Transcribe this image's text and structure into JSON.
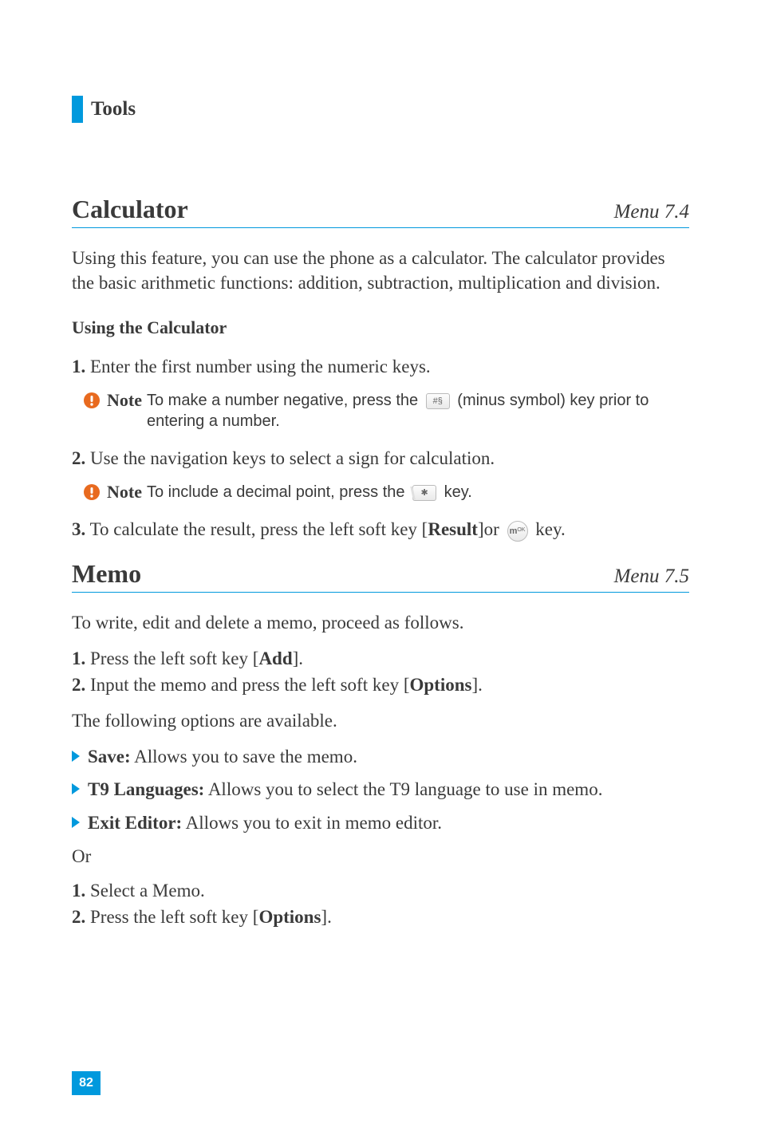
{
  "header": {
    "title": "Tools"
  },
  "section1": {
    "heading": "Calculator",
    "menu_ref": "Menu 7.4",
    "intro": "Using this feature, you can use the phone as a calculator. The calculator provides the basic arithmetic functions: addition, subtraction, multiplication and division.",
    "subheading": "Using the Calculator",
    "step1_num": "1.",
    "step1_text": " Enter the first number using the numeric keys.",
    "note1_label": "Note",
    "note1_pre": "To make a number negative, press the ",
    "note1_post": " (minus symbol) key prior to entering a number.",
    "hash_key_glyph": "#§",
    "step2_num": "2.",
    "step2_text": " Use the navigation keys to select a sign for calculation.",
    "note2_label": "Note",
    "note2_pre": "To include a decimal point, press the ",
    "note2_post": " key.",
    "star_key_glyph": "✱",
    "step3_num": "3.",
    "step3_pre": " To calculate the result, press the left soft key [",
    "step3_result": "Result",
    "step3_mid": "]or ",
    "step3_post": " key.",
    "ok_key_top": "m",
    "ok_key_sub": "OK"
  },
  "section2": {
    "heading": "Memo",
    "menu_ref": "Menu 7.5",
    "intro": "To write, edit and delete a memo, proceed as follows.",
    "step1_num": "1.",
    "step1_pre": " Press the left soft key [",
    "step1_bold": "Add",
    "step1_post": "].",
    "step2_num": "2.",
    "step2_pre": " Input the memo and press the left soft key [",
    "step2_bold": "Options",
    "step2_post": "].",
    "options_intro": "The following options are available.",
    "bullet1_bold": "Save:",
    "bullet1_rest": " Allows you to save the memo.",
    "bullet2_bold": "T9 Languages:",
    "bullet2_rest": " Allows you to select the T9 language to use in memo.",
    "bullet3_bold": "Exit Editor:",
    "bullet3_rest": " Allows you to exit in memo editor.",
    "or_text": "Or",
    "alt_step1_num": "1.",
    "alt_step1_text": " Select a Memo.",
    "alt_step2_num": "2.",
    "alt_step2_pre": " Press the left soft key [",
    "alt_step2_bold": "Options",
    "alt_step2_post": "]."
  },
  "page_number": "82"
}
